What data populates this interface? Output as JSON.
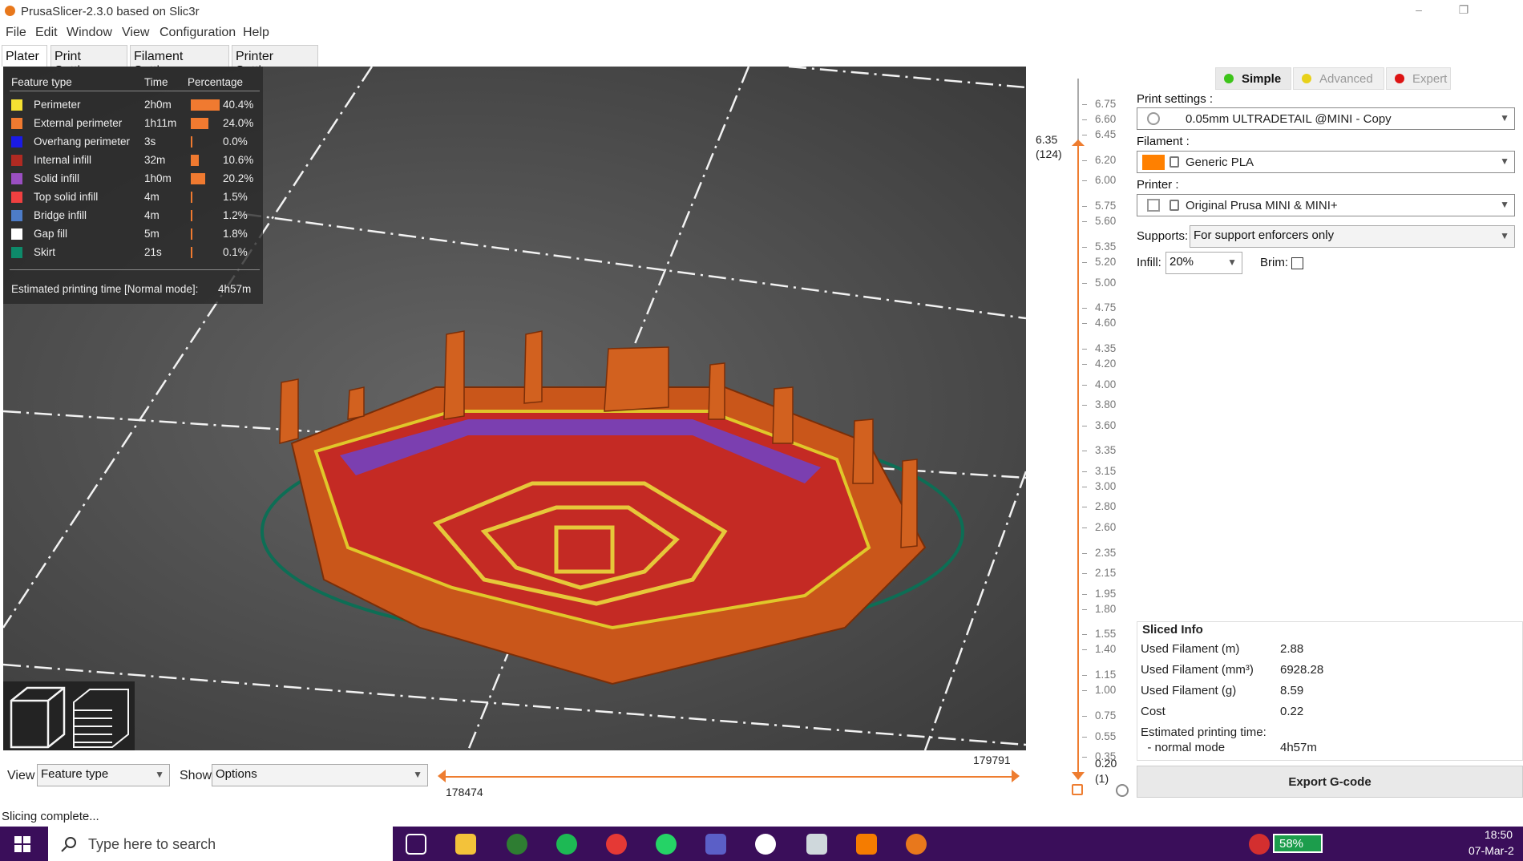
{
  "window": {
    "title": "PrusaSlicer-2.3.0 based on Slic3r"
  },
  "menu": [
    "File",
    "Edit",
    "Window",
    "View",
    "Configuration",
    "Help"
  ],
  "tabs": [
    "Plater",
    "Print Settings",
    "Filament Settings",
    "Printer Settings"
  ],
  "legend": {
    "headers": {
      "type": "Feature type",
      "time": "Time",
      "pct": "Percentage"
    },
    "rows": [
      {
        "name": "Perimeter",
        "time": "2h0m",
        "pct": "40.4%",
        "color": "#f5e132",
        "frac": 0.404
      },
      {
        "name": "External perimeter",
        "time": "1h11m",
        "pct": "24.0%",
        "color": "#f07a30",
        "frac": 0.24
      },
      {
        "name": "Overhang perimeter",
        "time": "3s",
        "pct": "0.0%",
        "color": "#1a1ae6",
        "frac": 0.0
      },
      {
        "name": "Internal infill",
        "time": "32m",
        "pct": "10.6%",
        "color": "#b02a22",
        "frac": 0.106
      },
      {
        "name": "Solid infill",
        "time": "1h0m",
        "pct": "20.2%",
        "color": "#9a4fc2",
        "frac": 0.202
      },
      {
        "name": "Top solid infill",
        "time": "4m",
        "pct": "1.5%",
        "color": "#f04040",
        "frac": 0.015
      },
      {
        "name": "Bridge infill",
        "time": "4m",
        "pct": "1.2%",
        "color": "#4d7cc8",
        "frac": 0.012
      },
      {
        "name": "Gap fill",
        "time": "5m",
        "pct": "1.8%",
        "color": "#ffffff",
        "frac": 0.018
      },
      {
        "name": "Skirt",
        "time": "21s",
        "pct": "0.1%",
        "color": "#0d8a6a",
        "frac": 0.001
      }
    ],
    "total_label": "Estimated printing time [Normal mode]:",
    "total_value": "4h57m"
  },
  "bottom": {
    "view_label": "View",
    "view_value": "Feature type",
    "show_label": "Show",
    "show_value": "Options"
  },
  "hslider": {
    "top": "179791",
    "bottom": "178474"
  },
  "vslider": {
    "current_value": "6.35",
    "current_layer": "(124)",
    "bottom_value": "0.20",
    "bottom_layer": "(1)",
    "ticks": [
      "6.75",
      "6.60",
      "6.45",
      "6.20",
      "6.00",
      "5.75",
      "5.60",
      "5.35",
      "5.20",
      "5.00",
      "4.75",
      "4.60",
      "4.35",
      "4.20",
      "4.00",
      "3.80",
      "3.60",
      "3.35",
      "3.15",
      "3.00",
      "2.80",
      "2.60",
      "2.35",
      "2.15",
      "1.95",
      "1.80",
      "1.55",
      "1.40",
      "1.15",
      "1.00",
      "0.75",
      "0.55",
      "0.35"
    ]
  },
  "sidebar": {
    "modes": [
      "Simple",
      "Advanced",
      "Expert"
    ],
    "mode_colors": [
      "#3dc41a",
      "#e8d11a",
      "#dd1414"
    ],
    "print_label": "Print settings :",
    "print_value": "0.05mm ULTRADETAIL @MINI - Copy",
    "filament_label": "Filament :",
    "filament_value": "Generic PLA",
    "filament_color": "#ff8000",
    "printer_label": "Printer :",
    "printer_value": "Original Prusa MINI & MINI+",
    "supports_label": "Supports:",
    "supports_value": "For support enforcers only",
    "infill_label": "Infill:",
    "infill_value": "20%",
    "brim_label": "Brim:"
  },
  "sliced_info": {
    "title": "Sliced Info",
    "rows": [
      {
        "label": "Used Filament (m)",
        "value": "2.88"
      },
      {
        "label": "Used Filament (mm³)",
        "value": "6928.28"
      },
      {
        "label": "Used Filament (g)",
        "value": "8.59"
      },
      {
        "label": "Cost",
        "value": "0.22"
      },
      {
        "label": "Estimated printing time:",
        "value": ""
      },
      {
        "label": "  - normal mode",
        "value": "4h57m"
      }
    ]
  },
  "export_label": "Export G-code",
  "status": "Slicing complete...",
  "taskbar": {
    "search_placeholder": "Type here to search",
    "battery": "58%",
    "time": "18:50",
    "date": "07-Mar-2"
  }
}
